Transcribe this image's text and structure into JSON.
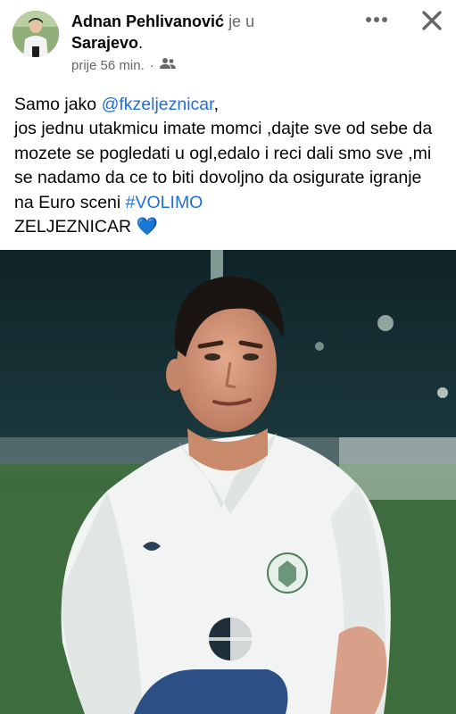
{
  "author": {
    "name": "Adnan Pehlivanović",
    "verb": "je u",
    "place": "Sarajevo",
    "place_suffix": "."
  },
  "meta": {
    "time": "prije 56 min.",
    "separator": "·",
    "audience_icon": "friends-icon"
  },
  "actions": {
    "more_icon": "more-horizontal-icon",
    "close_icon": "close-icon"
  },
  "post": {
    "line1_text": "Samo jako ",
    "mention": "@fkzeljeznicar",
    "line1_end": ",",
    "body": " jos jednu utakmicu imate momci ,dajte sve od sebe da mozete se pogledati u ogl,edalo i reci dali smo sve ,mi se nadamo da ce to biti dovoljno da osigurate igranje na Euro sceni ",
    "hashtag": "#VOLIMO",
    "tail": "ZELJEZNICAR",
    "emoji": "💙"
  },
  "colors": {
    "link": "#216fdb",
    "secondary_text": "#65676b",
    "heart": "#5aa9e6"
  }
}
